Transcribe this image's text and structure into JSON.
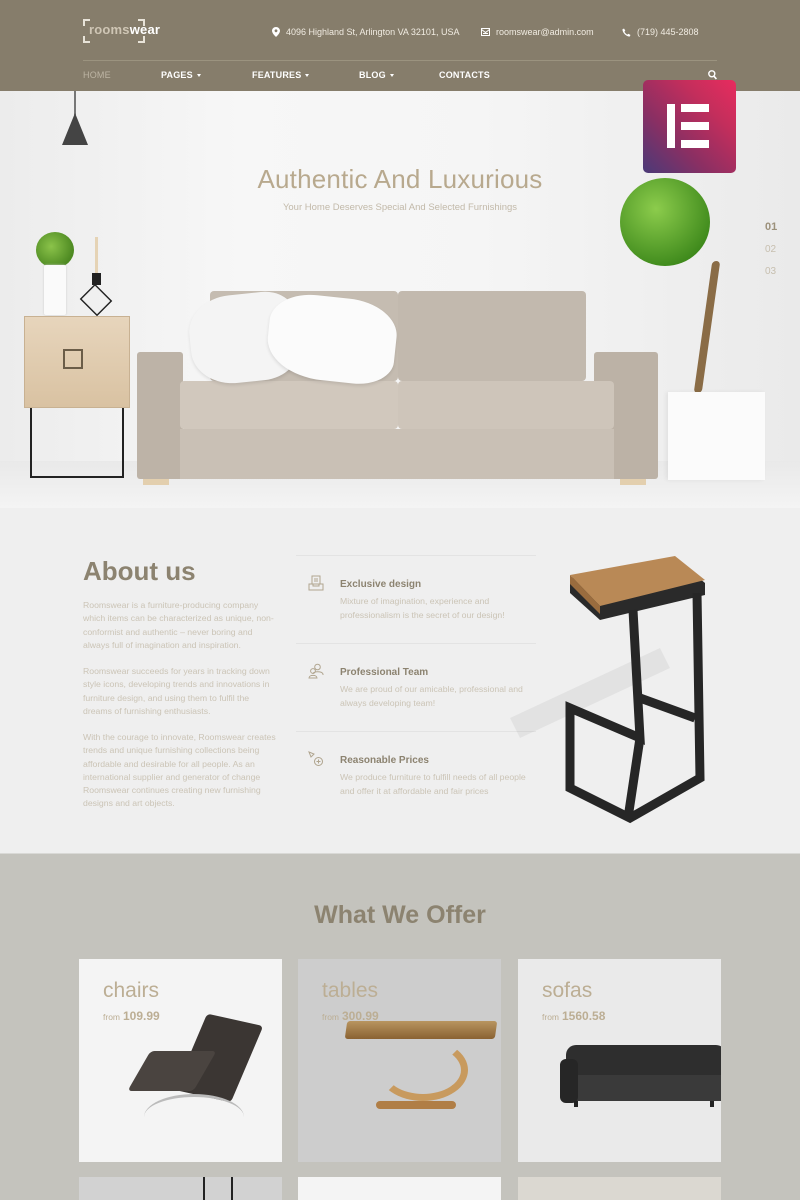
{
  "brand": {
    "logo_part1": "rooms",
    "logo_part2": "wear"
  },
  "header": {
    "address": "4096 Highland St, Arlington VA 32101, USA",
    "email": "roomswear@admin.com",
    "phone": "(719) 445-2808",
    "icons": {
      "address": "map-pin-icon",
      "email": "envelope-icon",
      "phone": "phone-icon",
      "search": "search-icon"
    }
  },
  "nav": {
    "items": [
      {
        "label": "HOME",
        "active": true,
        "dropdown": false
      },
      {
        "label": "PAGES",
        "active": false,
        "dropdown": true
      },
      {
        "label": "FEATURES",
        "active": false,
        "dropdown": true
      },
      {
        "label": "BLOG",
        "active": false,
        "dropdown": true
      },
      {
        "label": "CONTACTS",
        "active": false,
        "dropdown": false
      }
    ]
  },
  "badge": {
    "name": "elementor-logo",
    "gradient_start": "#4a3a78",
    "gradient_end": "#e82c5e"
  },
  "hero": {
    "title": "Authentic And Luxurious",
    "subtitle": "Your Home Deserves Special And Selected Furnishings",
    "slides": [
      "01",
      "02",
      "03"
    ],
    "active_slide": "01"
  },
  "about": {
    "title": "About us",
    "paragraphs": [
      "Roomswear is a furniture-producing company which items can be characterized as unique, non-conformist and authentic – never boring and always full of imagination and inspiration.",
      "Roomswear succeeds for years in tracking down style icons, developing trends and innovations in furniture design, and using them to fulfil the dreams of furnishing enthusiasts.",
      "With the courage to innovate, Roomswear creates trends and unique furnishing collections being affordable and desirable for all people. As an international supplier and generator of change Roomswear continues creating new furnishing designs and art objects."
    ],
    "features": [
      {
        "icon": "inbox-tray-icon",
        "title": "Exclusive design",
        "text": "Mixture of imagination, experience and professionalism is the secret of our design!"
      },
      {
        "icon": "team-icon",
        "title": "Professional Team",
        "text": "We are proud of our amicable, professional and always developing team!"
      },
      {
        "icon": "price-tag-icon",
        "title": "Reasonable Prices",
        "text": "We produce furniture to fulfill needs of all people and offer it at affordable and fair prices"
      }
    ]
  },
  "offer": {
    "title": "What We Offer",
    "from_label": "from",
    "cards": [
      {
        "name": "chairs",
        "price": "109.99"
      },
      {
        "name": "tables",
        "price": "300.99"
      },
      {
        "name": "sofas",
        "price": "1560.58"
      }
    ]
  },
  "colors": {
    "header_bg": "#867d6b",
    "accent_text": "#b8a98e",
    "heading_dark": "#8c8370",
    "offer_bg": "#c4c3bd",
    "body_text": "#cbc4b6"
  }
}
